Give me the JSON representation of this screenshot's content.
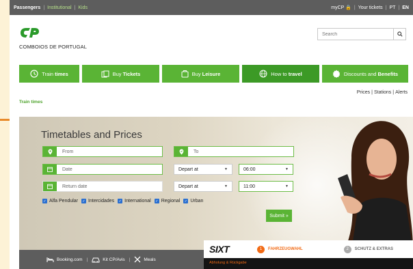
{
  "topbar": {
    "passengers": "Passengers",
    "institutional": "Institutional",
    "kids": "Kids",
    "mycp": "myCP",
    "your_tickets": "Your tickets",
    "pt": "PT",
    "en": "EN"
  },
  "header": {
    "logo_text": "COMBOIOS DE PORTUGAL",
    "search_placeholder": "Search"
  },
  "nav": {
    "items": [
      {
        "pre": "Train ",
        "bold": "times",
        "icon": "clock-icon"
      },
      {
        "pre": "Buy ",
        "bold": "Tickets",
        "icon": "tickets-icon"
      },
      {
        "pre": "Buy ",
        "bold": "Leisure",
        "icon": "leisure-icon"
      },
      {
        "pre": "How to ",
        "bold": "travel",
        "icon": "globe-icon"
      },
      {
        "pre": "Discounts and ",
        "bold": "Benefits",
        "icon": "badge-icon"
      }
    ]
  },
  "sublinks": {
    "prices": "Prices",
    "stations": "Stations",
    "alerts": "Alerts"
  },
  "breadcrumb": "Train times",
  "form": {
    "title": "Timetables and Prices",
    "from_placeholder": "From",
    "to_placeholder": "To",
    "date_placeholder": "Date",
    "return_placeholder": "Return date",
    "depart_label_1": "Depart at",
    "depart_label_2": "Depart at",
    "time_1": "06:00",
    "time_2": "11:00",
    "checks": [
      "Alfa Pendular",
      "Intercidades",
      "International",
      "Regional",
      "Urban"
    ],
    "submit": "Submit »"
  },
  "bottombar": {
    "booking": "Booking.com",
    "kit": "Kit CP/Avis",
    "meals": "Meals"
  },
  "ad": {
    "brand": "SIXT",
    "step1_num": "1",
    "step1": "FAHRZEUGWAHL",
    "step2_num": "2",
    "step2": "SCHUTZ & EXTRAS",
    "bottom": "Abholung & Rückgabe"
  },
  "colors": {
    "green": "#5ab435",
    "dark_green": "#3c9a26",
    "topbar": "#5d5d5d",
    "orange": "#f26a14"
  }
}
